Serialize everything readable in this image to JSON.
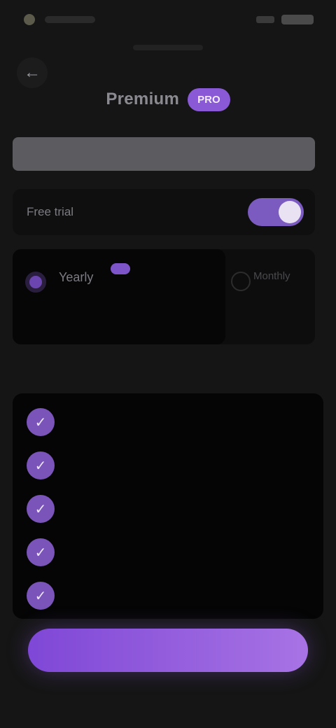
{
  "status_bar": {
    "time": "",
    "battery": ""
  },
  "header": {
    "back_icon": "arrow-left-icon",
    "back_glyph": "←",
    "title": "Premium",
    "badge": "PRO"
  },
  "subtitle": "",
  "trial_toggle": {
    "label": "Free trial",
    "enabled": true
  },
  "plans": {
    "yearly": {
      "name": "Yearly",
      "badge": "",
      "price": "",
      "selected": true
    },
    "monthly": {
      "name": "Monthly",
      "price": "",
      "selected": false
    }
  },
  "features": {
    "title": "",
    "check_glyph": "✓",
    "items": [
      {
        "label": ""
      },
      {
        "label": ""
      },
      {
        "label": ""
      },
      {
        "label": ""
      },
      {
        "label": ""
      }
    ]
  },
  "cta": {
    "label": ""
  },
  "footer": {
    "links": [
      "",
      ""
    ]
  },
  "colors": {
    "accent": "#8a5ad6",
    "background": "#151515",
    "cta_gradient_start": "#7f47d6",
    "cta_gradient_end": "#a773e4"
  }
}
